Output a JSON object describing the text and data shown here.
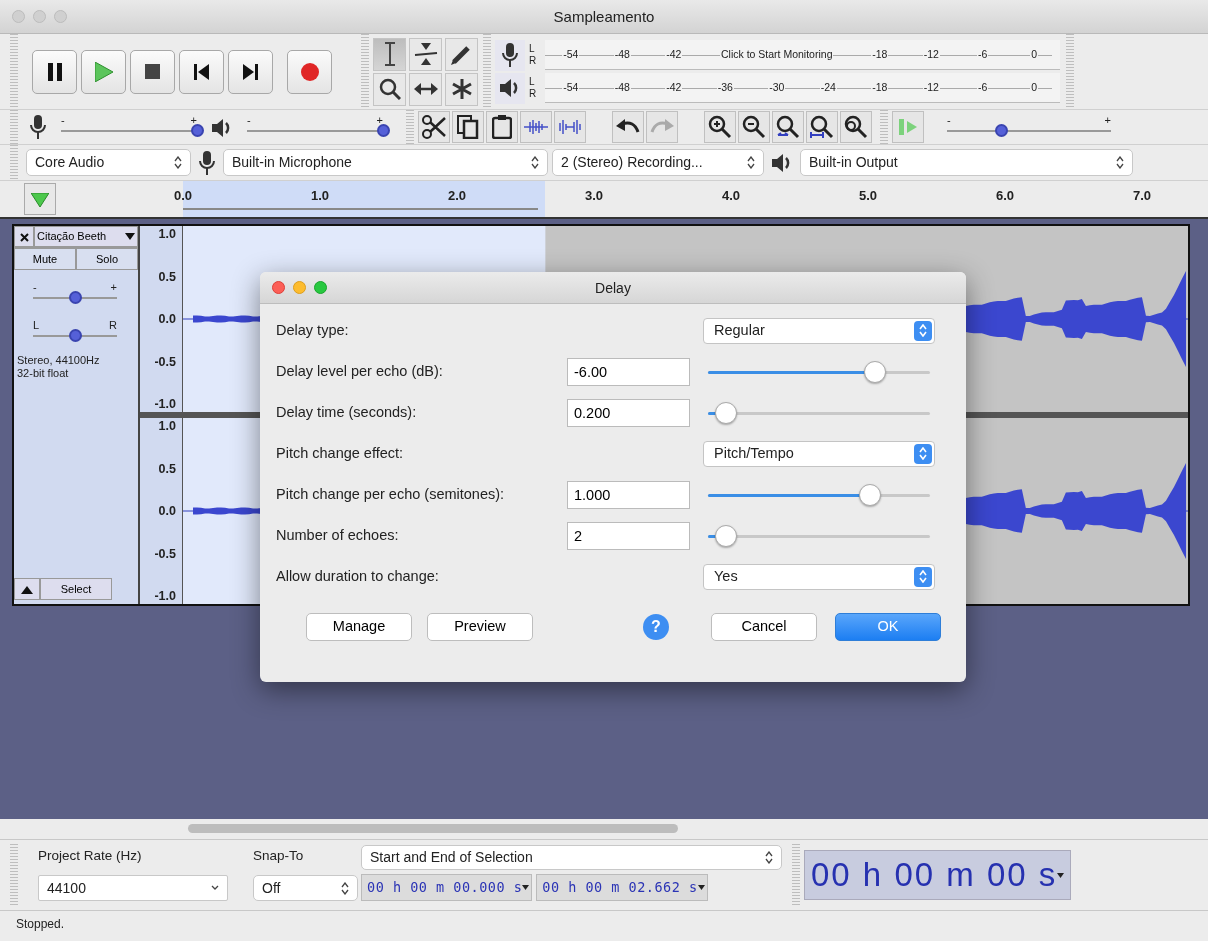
{
  "window": {
    "title": "Sampleamento"
  },
  "tools": [
    {
      "kind": "ibeam",
      "selected": true
    },
    {
      "kind": "envelope",
      "selected": false
    },
    {
      "kind": "draw",
      "selected": false
    },
    {
      "kind": "zoom",
      "selected": false
    },
    {
      "kind": "timeshift",
      "selected": false
    },
    {
      "kind": "multi",
      "selected": false
    }
  ],
  "meters": [
    {
      "kind": "record",
      "channels": [
        "L",
        "R"
      ],
      "ticks": [
        {
          "text": "-54"
        },
        {
          "text": "-48"
        },
        {
          "text": "-42"
        },
        {
          "text": "Click to Start Monitoring",
          "kind": "hint"
        },
        {
          "text": "-18"
        },
        {
          "text": "-12"
        },
        {
          "text": "-6"
        },
        {
          "text": "0"
        }
      ]
    },
    {
      "kind": "playback",
      "channels": [
        "L",
        "R"
      ],
      "ticks": [
        {
          "text": "-54"
        },
        {
          "text": "-48"
        },
        {
          "text": "-42"
        },
        {
          "text": "-36"
        },
        {
          "text": "-30"
        },
        {
          "text": "-24"
        },
        {
          "text": "-18"
        },
        {
          "text": "-12"
        },
        {
          "text": "-6"
        },
        {
          "text": "0"
        }
      ]
    }
  ],
  "mixer": [
    {
      "kind": "record",
      "minus": "-",
      "plus": "+",
      "level": 1.0
    },
    {
      "kind": "playback",
      "minus": "-",
      "plus": "+",
      "level": 1.0
    }
  ],
  "play_at_speed": {
    "minus": "-",
    "plus": "+",
    "level": 0.33
  },
  "devices": {
    "host": "Core Audio",
    "input": "Built-in Microphone",
    "channels": "2 (Stereo) Recording...",
    "output": "Built-in Output"
  },
  "ruler": {
    "ticks": [
      "0.0",
      "1.0",
      "2.0",
      "3.0",
      "4.0",
      "5.0",
      "6.0",
      "7.0"
    ]
  },
  "track": {
    "name": "Citação Beeth",
    "buttons": [
      "Mute",
      "Solo"
    ],
    "gain": {
      "minus": "-",
      "plus": "+",
      "level": 0.5
    },
    "pan": {
      "left": "L",
      "right": "R",
      "level": 0.5
    },
    "info": [
      "Stereo, 44100Hz",
      "32-bit float"
    ],
    "select": "Select",
    "channels": [
      {
        "scale": [
          "1.0",
          "0.5",
          "0.0",
          "-0.5",
          "-1.0"
        ]
      },
      {
        "scale": [
          "1.0",
          "0.5",
          "0.0",
          "-0.5",
          "-1.0"
        ]
      }
    ]
  },
  "dialog": {
    "title": "Delay",
    "rows": [
      {
        "kind": "select",
        "label": "Delay type:",
        "value": "Regular"
      },
      {
        "kind": "number",
        "label": "Delay level per echo (dB):",
        "value": "-6.00",
        "level": 0.75
      },
      {
        "kind": "number",
        "label": "Delay time (seconds):",
        "value": "0.200",
        "level": 0.08
      },
      {
        "kind": "select",
        "label": "Pitch change effect:",
        "value": "Pitch/Tempo"
      },
      {
        "kind": "number",
        "label": "Pitch change per echo (semitones):",
        "value": "1.000",
        "level": 0.73
      },
      {
        "kind": "number",
        "label": "Number of echoes:",
        "value": "2",
        "level": 0.08
      },
      {
        "kind": "select",
        "label": "Allow duration to change:",
        "value": "Yes"
      }
    ],
    "buttons": [
      {
        "label": "Manage",
        "kind": "plain"
      },
      {
        "label": "Preview",
        "kind": "plain"
      },
      {
        "label": "?",
        "kind": "help"
      },
      {
        "label": "Cancel",
        "kind": "plain"
      },
      {
        "label": "OK",
        "kind": "default"
      }
    ]
  },
  "selection_bar": {
    "rate_label": "Project Rate (Hz)",
    "rate": "44100",
    "snap_label": "Snap-To",
    "snap": "Off",
    "mode": "Start and End of Selection",
    "start": "00 h 00 m 00.000 s",
    "end": "00 h 00 m 02.662 s",
    "audio_position": "00 h 00 m 00 s"
  },
  "status_bar": "Stopped."
}
